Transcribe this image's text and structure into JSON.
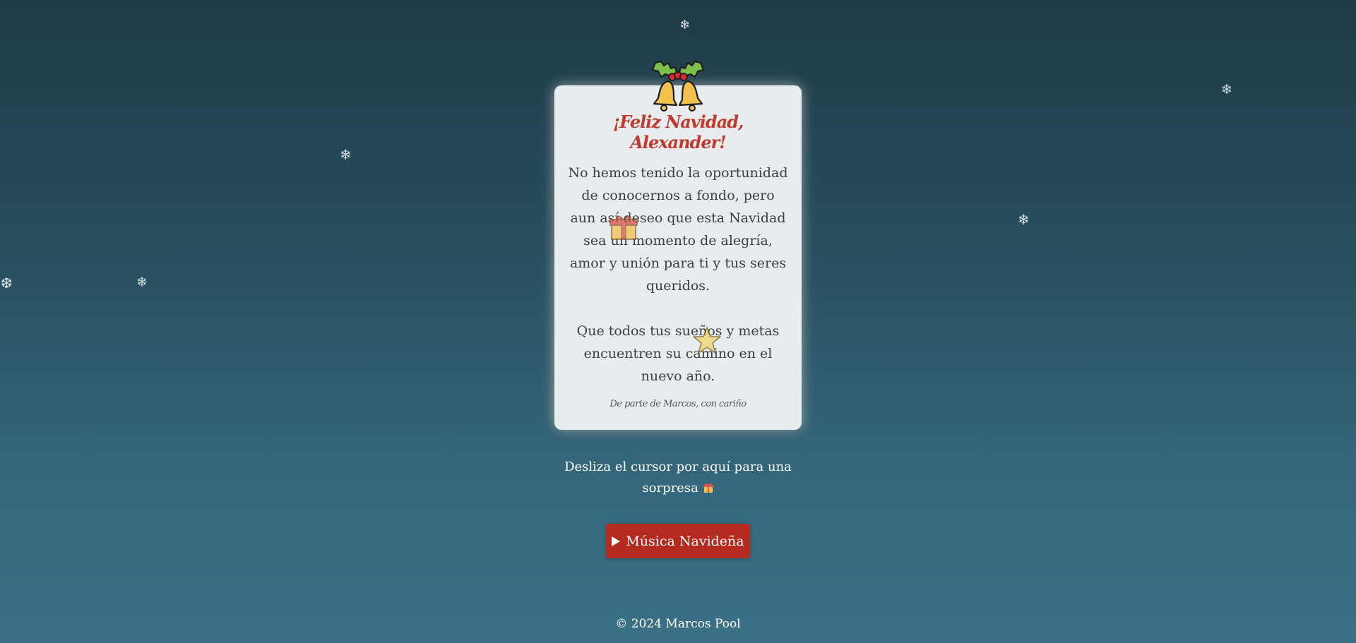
{
  "snowflakes": [
    "❄",
    "❄",
    "❄",
    "❄",
    "❆",
    "❄",
    "❆"
  ],
  "card": {
    "title": "¡Feliz Navidad, Alexander!",
    "message_paragraph_1": "No hemos tenido la oportunidad de conocernos a fondo, pero aun así deseo que esta Navidad sea un momento de alegría, amor y unión para ti y tus seres queridos.",
    "message_paragraph_2": "Que todos tus sueños y metas encuentren su camino en el nuevo año.",
    "signature": "De parte de Marcos, con cariño"
  },
  "hint_text": "Desliza el cursor por aquí para una sorpresa",
  "music_button": {
    "label": "Música Navideña"
  },
  "footer": "© 2024 Marcos Pool",
  "icons": {
    "bells": "bells-icon",
    "gift": "gift-icon",
    "star": "star-icon",
    "play": "play-icon"
  },
  "colors": {
    "title": "#c0392b",
    "button": "#b52a1f",
    "card_background": "#e8ecee"
  }
}
